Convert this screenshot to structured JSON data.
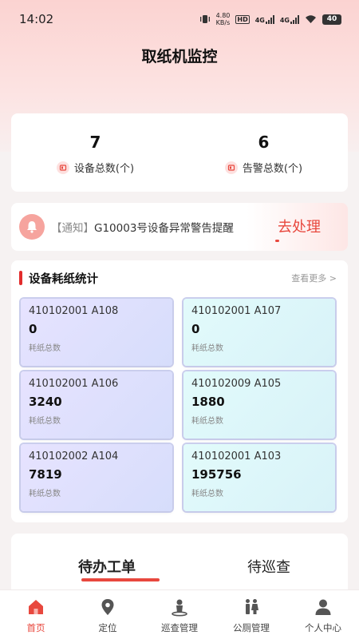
{
  "status_bar": {
    "time": "14:02",
    "net_speed_top": "4.80",
    "net_speed_bottom": "KB/s",
    "hd": "HD",
    "sim1": "4G",
    "sim2": "4G",
    "battery": "40"
  },
  "header": {
    "title": "取纸机监控"
  },
  "stats": {
    "device_total": {
      "value": "7",
      "label": "设备总数(个)"
    },
    "alarm_total": {
      "value": "6",
      "label": "告警总数(个)"
    }
  },
  "notice": {
    "tag": "【通知】",
    "text": "G10003号设备异常警告提醒",
    "action": "去处理"
  },
  "consumption": {
    "title": "设备耗纸统计",
    "more": "查看更多 >",
    "items": [
      {
        "id": "410102001 A108",
        "value": "0",
        "label": "耗纸总数"
      },
      {
        "id": "410102001 A107",
        "value": "0",
        "label": "耗纸总数"
      },
      {
        "id": "410102001 A106",
        "value": "3240",
        "label": "耗纸总数"
      },
      {
        "id": "410102009 A105",
        "value": "1880",
        "label": "耗纸总数"
      },
      {
        "id": "410102002 A104",
        "value": "7819",
        "label": "耗纸总数"
      },
      {
        "id": "410102001 A103",
        "value": "195756",
        "label": "耗纸总数"
      }
    ]
  },
  "tabs": {
    "pending_orders": "待办工单",
    "pending_patrol": "待巡查"
  },
  "nav": [
    {
      "label": "首页",
      "icon": "home-icon"
    },
    {
      "label": "定位",
      "icon": "location-pin-icon"
    },
    {
      "label": "巡查管理",
      "icon": "patrol-icon"
    },
    {
      "label": "公厕管理",
      "icon": "restroom-icon"
    },
    {
      "label": "个人中心",
      "icon": "user-icon"
    }
  ],
  "colors": {
    "accent": "#e8483e",
    "title_bar": "#e22c2c"
  }
}
